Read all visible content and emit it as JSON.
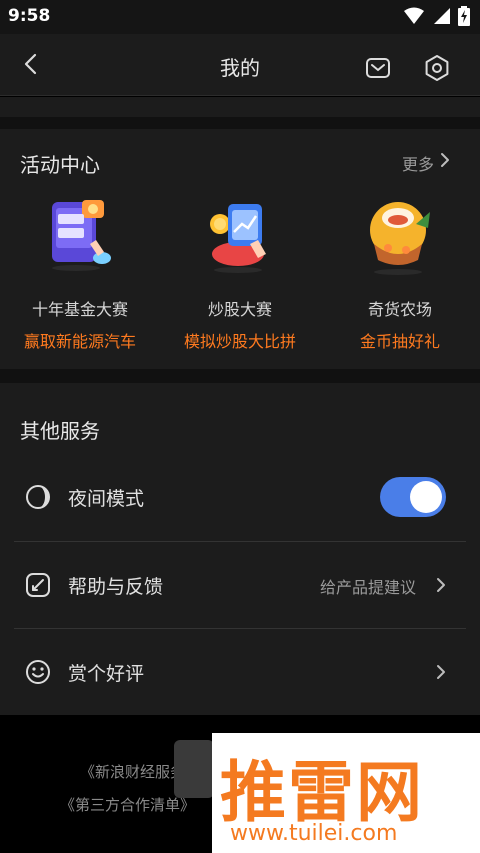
{
  "status_bar": {
    "time": "9:58",
    "icons": [
      "wifi-icon",
      "signal-icon",
      "battery-charging-icon"
    ]
  },
  "nav": {
    "title": "我的",
    "icons": [
      "back-icon",
      "mail-icon",
      "settings-gear-icon"
    ]
  },
  "activity": {
    "header": "活动中心",
    "more": "更多",
    "items": [
      {
        "name": "十年基金大赛",
        "promo": "赢取新能源汽车",
        "icon": "fund-contest-icon"
      },
      {
        "name": "炒股大赛",
        "promo": "模拟炒股大比拼",
        "icon": "stock-contest-icon"
      },
      {
        "name": "奇货农场",
        "promo": "金币抽好礼",
        "icon": "farm-icon"
      }
    ]
  },
  "services": {
    "header": "其他服务",
    "rows": [
      {
        "label": "夜间模式",
        "icon": "night-mode-icon",
        "toggle_on": true
      },
      {
        "label": "帮助与反馈",
        "aux": "给产品提建议",
        "icon": "help-feedback-icon"
      },
      {
        "label": "赏个好评",
        "icon": "smile-icon"
      }
    ]
  },
  "footer": {
    "line1": "《新浪财经服务协",
    "line2": "《第三方合作清单》"
  },
  "watermark": {
    "text": "推雷网",
    "url": "www.tuilei.com"
  },
  "colors": {
    "accent_orange": "#ff7a1f",
    "toggle_blue": "#4a7ee8",
    "panel": "#1c1c1c"
  }
}
